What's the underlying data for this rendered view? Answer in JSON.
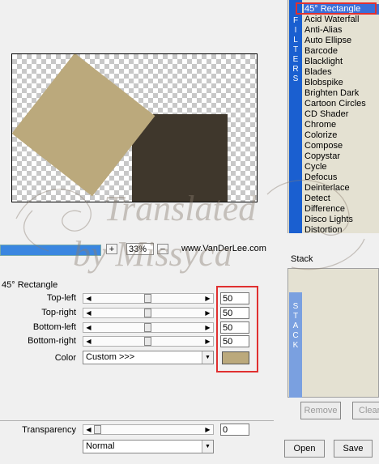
{
  "filters": {
    "strip_label": "FILTERS",
    "items": [
      "45° Rectangle",
      "Acid Waterfall",
      "Anti-Alias",
      "Auto Ellipse",
      "Barcode",
      "Blacklight",
      "Blades",
      "Blobspike",
      "Brighten Dark",
      "Cartoon Circles",
      "CD Shader",
      "Chrome",
      "Colorize",
      "Compose",
      "Copystar",
      "Cycle",
      "Defocus",
      "Deinterlace",
      "Detect",
      "Difference",
      "Disco Lights",
      "Distortion"
    ],
    "selected_index": 0
  },
  "toolbar": {
    "plus": "+",
    "zoom": "33%",
    "minus": "−",
    "site": "www.VanDerLee.com"
  },
  "settings": {
    "title": "45° Rectangle",
    "params": [
      {
        "label": "Top-left",
        "value": "50"
      },
      {
        "label": "Top-right",
        "value": "50"
      },
      {
        "label": "Bottom-left",
        "value": "50"
      },
      {
        "label": "Bottom-right",
        "value": "50"
      }
    ],
    "color_label": "Color",
    "color_value": "Custom >>>",
    "color_hex": "#bba97c",
    "transparency_label": "Transparency",
    "transparency_value": "0",
    "blend_value": "Normal"
  },
  "stack": {
    "title": "Stack",
    "strip_label": "STACK",
    "remove": "Remove",
    "clear": "Clear"
  },
  "buttons": {
    "open": "Open",
    "save": "Save"
  },
  "preview": {
    "shape_color": "#bba97c",
    "dark_color": "#3f372c"
  },
  "watermark": {
    "line1": "Translated",
    "line2": "by Missyca"
  }
}
